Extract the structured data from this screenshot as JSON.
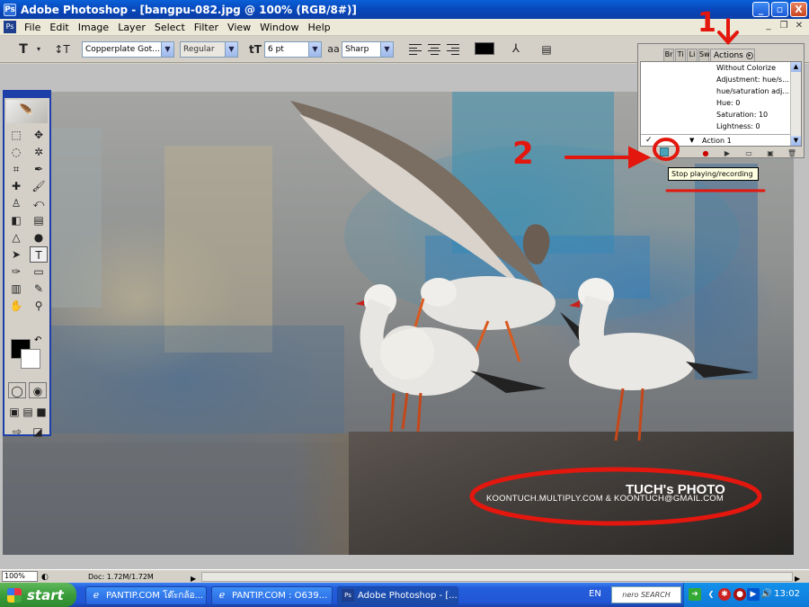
{
  "window": {
    "title": "Adobe Photoshop - [bangpu-082.jpg @ 100% (RGB/8#)]",
    "buttons": {
      "minimize": "_",
      "restore": "▫",
      "close": "X"
    }
  },
  "menu": {
    "items": [
      "File",
      "Edit",
      "Image",
      "Layer",
      "Select",
      "Filter",
      "View",
      "Window",
      "Help"
    ]
  },
  "options": {
    "tool_icon": "T",
    "font_family": "Copperplate Got...",
    "font_style": "Regular",
    "font_size": "6 pt",
    "aa_label": "aa",
    "antialias": "Sharp",
    "text_color": "#000000"
  },
  "palette": {
    "tabs": [
      "Br",
      "Ti",
      "Li",
      "Sw"
    ],
    "active_tab": "Actions",
    "rows": [
      "Without Colorize",
      "Adjustment: hue/s...",
      "hue/saturation adj...",
      "Hue: 0",
      "Saturation: 10",
      "Lightness: 0"
    ],
    "action_row": "Action 1",
    "tooltip": "Stop playing/recording"
  },
  "photo": {
    "watermark_title": "TUCH's PHOTO",
    "watermark_sub": "KOONTUCH.MULTIPLY.COM & KOONTUCH@GMAIL.COM"
  },
  "annotations": {
    "label_1": "1",
    "label_2": "2",
    "color": "#e3170e"
  },
  "status": {
    "zoom": "100%",
    "doc_info": "Doc: 1.72M/1.72M"
  },
  "taskbar": {
    "start_label": "start",
    "tasks": [
      "PANTIP.COM โต๊ะกล้อ...",
      "PANTIP.COM : O639...",
      "Adobe Photoshop - [..."
    ],
    "language": "EN",
    "search_widget": "nero SEARCH",
    "clock": "13:02"
  }
}
